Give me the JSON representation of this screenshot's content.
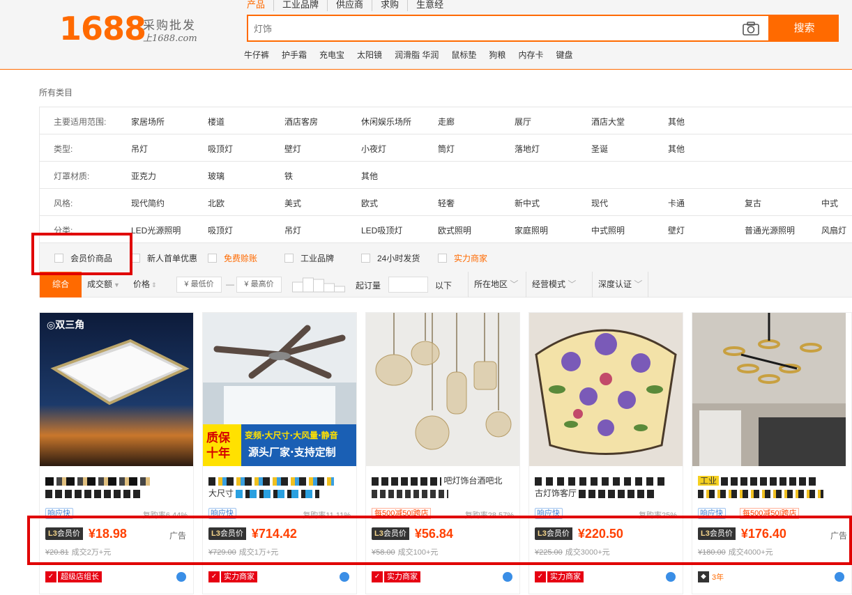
{
  "header": {
    "logo_num": "1688",
    "logo_cn": "采购批发",
    "logo_url": "上1688.com",
    "search_tabs": [
      "产品",
      "工业品牌",
      "供应商",
      "求购",
      "生意经"
    ],
    "search_placeholder": "灯饰",
    "search_button": "搜索",
    "hot_words": [
      "牛仔裤",
      "护手霜",
      "充电宝",
      "太阳镜",
      "润滑脂 华润",
      "鼠标垫",
      "狗粮",
      "内存卡",
      "键盘"
    ]
  },
  "category": {
    "all_label": "所有类目",
    "rows": [
      {
        "label": "主要适用范围:",
        "items": [
          "家居场所",
          "楼道",
          "酒店客房",
          "休闲娱乐场所",
          "走廊",
          "展厅",
          "酒店大堂",
          "其他"
        ]
      },
      {
        "label": "类型:",
        "items": [
          "吊灯",
          "吸顶灯",
          "壁灯",
          "小夜灯",
          "筒灯",
          "落地灯",
          "圣诞",
          "其他"
        ]
      },
      {
        "label": "灯罩材质:",
        "items": [
          "亚克力",
          "玻璃",
          "铁",
          "其他"
        ]
      },
      {
        "label": "风格:",
        "items": [
          "现代简约",
          "北欧",
          "美式",
          "欧式",
          "轻奢",
          "新中式",
          "现代",
          "卡通",
          "复古",
          "中式"
        ]
      },
      {
        "label": "分类:",
        "items": [
          "LED光源照明",
          "吸顶灯",
          "吊灯",
          "LED吸顶灯",
          "欧式照明",
          "家庭照明",
          "中式照明",
          "壁灯",
          "普通光源照明",
          "风扇灯"
        ]
      }
    ]
  },
  "checks": [
    "会员价商品",
    "新人首单优惠",
    "免费赊账",
    "工业品牌",
    "24小时发货",
    "实力商家"
  ],
  "sort": {
    "tabs": [
      "综合",
      "成交额",
      "价格"
    ],
    "min_price": "¥ 最低价",
    "dash": "—",
    "max_price": "¥ 最高价",
    "moq_label": "起订量",
    "below": "以下",
    "dropdowns": [
      "所在地区",
      "经营模式",
      "深度认证"
    ]
  },
  "products": [
    {
      "title_suffix": "",
      "tag": "响应快",
      "repeat": "复购率6.44%",
      "level": "L3",
      "member": "会员价",
      "price": "¥18.98",
      "ad": "广告",
      "orig": "¥20.81",
      "deals": "成交2万+元",
      "shop_badge": "超级店组长"
    },
    {
      "title_suffix": "大尺寸",
      "tag": "响应快",
      "repeat": "复购率11.11%",
      "level": "L3",
      "member": "会员价",
      "price": "¥714.42",
      "ad": "",
      "orig": "¥729.00",
      "deals": "成交1万+元",
      "shop_badge": "实力商家"
    },
    {
      "title_suffix": "吧灯饰台酒吧北",
      "tag": "每500减50|跨店",
      "repeat": "复购率28.57%",
      "level": "L3",
      "member": "会员价",
      "price": "¥56.84",
      "ad": "",
      "orig": "¥58.00",
      "deals": "成交100+元",
      "shop_badge": "实力商家"
    },
    {
      "title_suffix": "古灯饰客厅",
      "tag": "响应快",
      "repeat": "复购率25%",
      "level": "L3",
      "member": "会员价",
      "price": "¥220.50",
      "ad": "",
      "orig": "¥225.00",
      "deals": "成交3000+元",
      "shop_badge": "实力商家"
    },
    {
      "title_suffix": "工业",
      "tag": "响应快",
      "tag2": "每500减50|跨店",
      "repeat": "",
      "level": "L3",
      "member": "会员价",
      "price": "¥176.40",
      "ad": "广告",
      "orig": "¥180.00",
      "deals": "成交4000+元",
      "shop_badge": "3年"
    }
  ],
  "colors": {
    "brand": "#ff6a00",
    "price": "#ff4000",
    "annotation": "#e00000"
  }
}
